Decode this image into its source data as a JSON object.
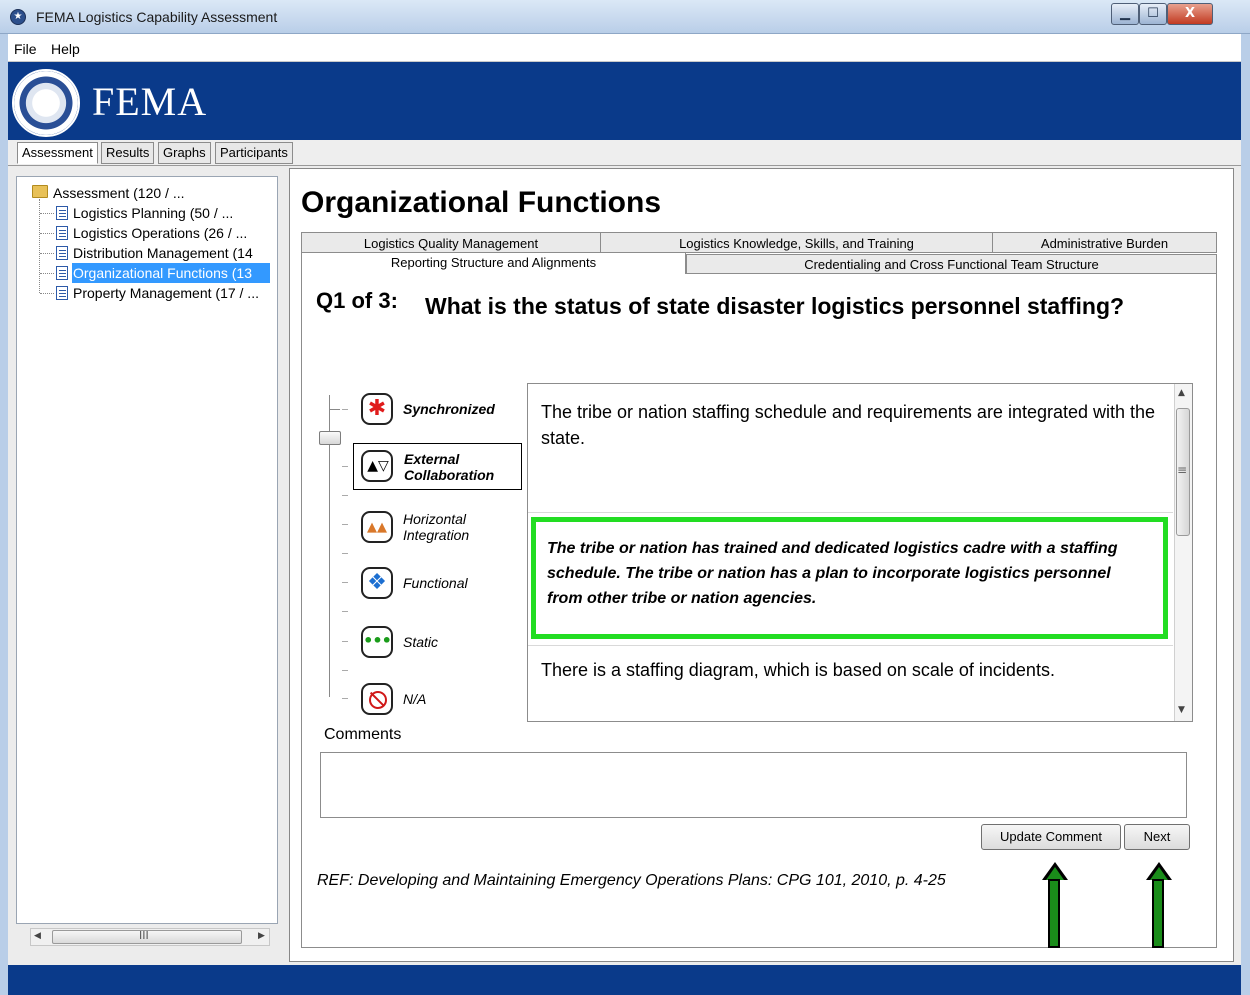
{
  "window": {
    "title": "FEMA Logistics Capability Assessment"
  },
  "menu": {
    "items": [
      "File",
      "Help"
    ]
  },
  "banner": {
    "logo_text": "FEMA",
    "bg_color": "#0a3a8a"
  },
  "main_tabs": [
    {
      "label": "Assessment",
      "active": true
    },
    {
      "label": "Results",
      "active": false
    },
    {
      "label": "Graphs",
      "active": false
    },
    {
      "label": "Participants",
      "active": false
    }
  ],
  "tree": {
    "root": "Assessment (120 / ...",
    "items": [
      {
        "label": "Logistics Planning (50 / ..."
      },
      {
        "label": "Logistics Operations (26 / ..."
      },
      {
        "label": "Distribution Management (14"
      },
      {
        "label": "Organizational Functions (13",
        "selected": true
      },
      {
        "label": "Property Management (17 / ..."
      }
    ],
    "scroll_grip": "III"
  },
  "content": {
    "title": "Organizational Functions",
    "subtabs_row1": [
      "Logistics Quality Management",
      "Logistics Knowledge, Skills, and Training",
      "Administrative Burden"
    ],
    "subtabs_row2": [
      {
        "label": "Reporting Structure and Alignments",
        "active": true
      },
      {
        "label": "Credentialing and Cross Functional Team Structure",
        "active": false
      }
    ],
    "question_number": "Q1 of 3:",
    "question_text": "What is the status of state disaster logistics personnel staffing?"
  },
  "levels": [
    {
      "label": "Synchronized",
      "icon": "red-asterisk-icon"
    },
    {
      "label": "External Collaboration",
      "icon": "triangles-up-down-icon",
      "selected": true
    },
    {
      "label": "Horizontal Integration",
      "icon": "orange-triangles-icon"
    },
    {
      "label": "Functional",
      "icon": "blue-diamond-icon"
    },
    {
      "label": "Static",
      "icon": "green-dots-icon"
    },
    {
      "label": "N/A",
      "icon": "not-applicable-icon"
    }
  ],
  "answers": {
    "top": "The tribe or nation staffing schedule and requirements are integrated with the state.",
    "selected": "The tribe or nation has trained and dedicated logistics cadre with a staffing schedule.  The tribe or nation has a plan to incorporate logistics personnel from other tribe or nation agencies.",
    "bottom": "There is a staffing diagram, which is based on scale of incidents.",
    "scroll_grip": "≡",
    "highlight_color": "#22dd22"
  },
  "comments": {
    "label": "Comments",
    "value": ""
  },
  "buttons": {
    "update_comment": "Update Comment",
    "next": "Next"
  },
  "reference": "REF: Developing and Maintaining Emergency Operations Plans:  CPG 101, 2010, p. 4-25",
  "annotation_arrow_color": "#1a8c1a"
}
